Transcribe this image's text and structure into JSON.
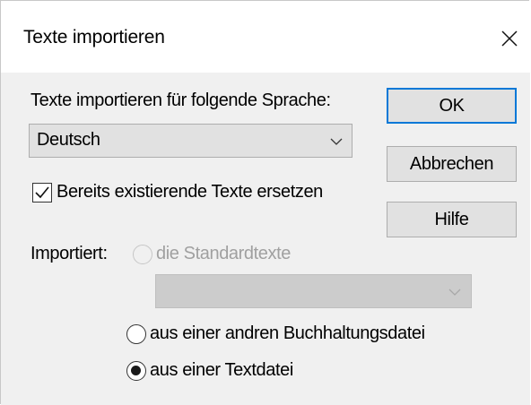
{
  "window": {
    "title": "Texte importieren"
  },
  "language": {
    "label": "Texte importieren für folgende Sprache:",
    "selected": "Deutsch"
  },
  "replace_checkbox": {
    "label": "Bereits existierende Texte ersetzen",
    "checked": true
  },
  "import": {
    "label": "Importiert:",
    "options": [
      {
        "label": "die Standardtexte",
        "selected": false,
        "enabled": false
      },
      {
        "label": "aus einer andren Buchhaltungsdatei",
        "selected": false,
        "enabled": true
      },
      {
        "label": "aus einer Textdatei",
        "selected": true,
        "enabled": true
      }
    ],
    "standard_dropdown": {
      "selected": "",
      "enabled": false
    }
  },
  "buttons": {
    "ok": "OK",
    "cancel": "Abbrechen",
    "help": "Hilfe"
  },
  "colors": {
    "accent": "#0078d7",
    "disabled_text": "#a0a0a0",
    "button_face": "#e1e1e1",
    "client_bg": "#f0f0f0"
  }
}
